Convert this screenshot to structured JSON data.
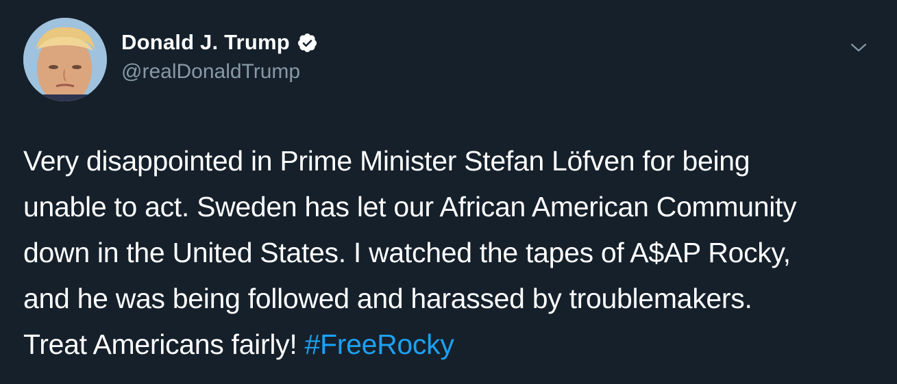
{
  "author": {
    "name": "Donald J. Trump",
    "handle": "@realDonaldTrump",
    "verified": true,
    "avatar_icon": "profile-photo"
  },
  "tweet": {
    "lines": [
      "Very disappointed in Prime Minister Stefan Löfven for being",
      "unable to act. Sweden has let our African American Community",
      "down in the United States. I watched the tapes of A$AP Rocky,",
      "and he was being followed and harassed by troublemakers.",
      "Treat Americans fairly! "
    ],
    "hashtag": "#FreeRocky"
  },
  "menu": {
    "icon": "chevron-down-icon"
  },
  "colors": {
    "background": "#15202b",
    "text": "#ffffff",
    "secondary_text": "#8899a6",
    "link": "#1da1f2"
  }
}
